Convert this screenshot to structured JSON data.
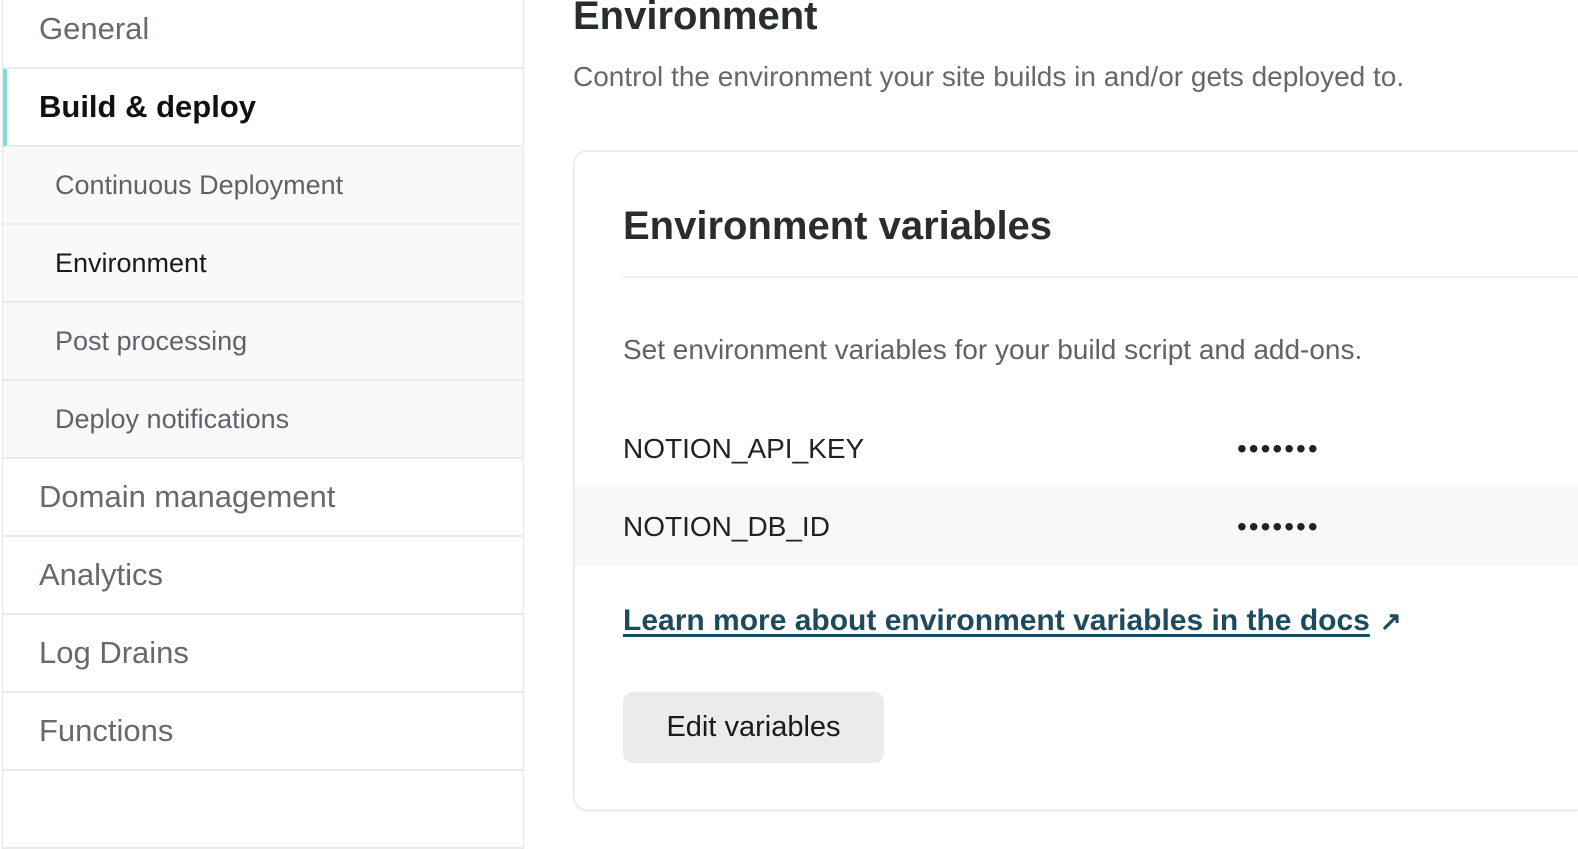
{
  "sidebar": {
    "items": [
      {
        "label": "General"
      },
      {
        "label": "Build & deploy"
      },
      {
        "label": "Continuous Deployment"
      },
      {
        "label": "Environment"
      },
      {
        "label": "Post processing"
      },
      {
        "label": "Deploy notifications"
      },
      {
        "label": "Domain management"
      },
      {
        "label": "Analytics"
      },
      {
        "label": "Log Drains"
      },
      {
        "label": "Functions"
      }
    ],
    "accent_color": "#7fdfd4"
  },
  "main": {
    "title": "Environment",
    "subtitle": "Control the environment your site builds in and/or gets deployed to.",
    "card": {
      "title": "Environment variables",
      "description": "Set environment variables for your build script and add-ons.",
      "variables": [
        {
          "key": "NOTION_API_KEY",
          "value": "•••••••"
        },
        {
          "key": "NOTION_DB_ID",
          "value": "•••••••"
        }
      ],
      "docs_link": "Learn more about environment variables in the docs",
      "docs_link_icon": "external-arrow-icon",
      "edit_button": "Edit variables"
    }
  }
}
